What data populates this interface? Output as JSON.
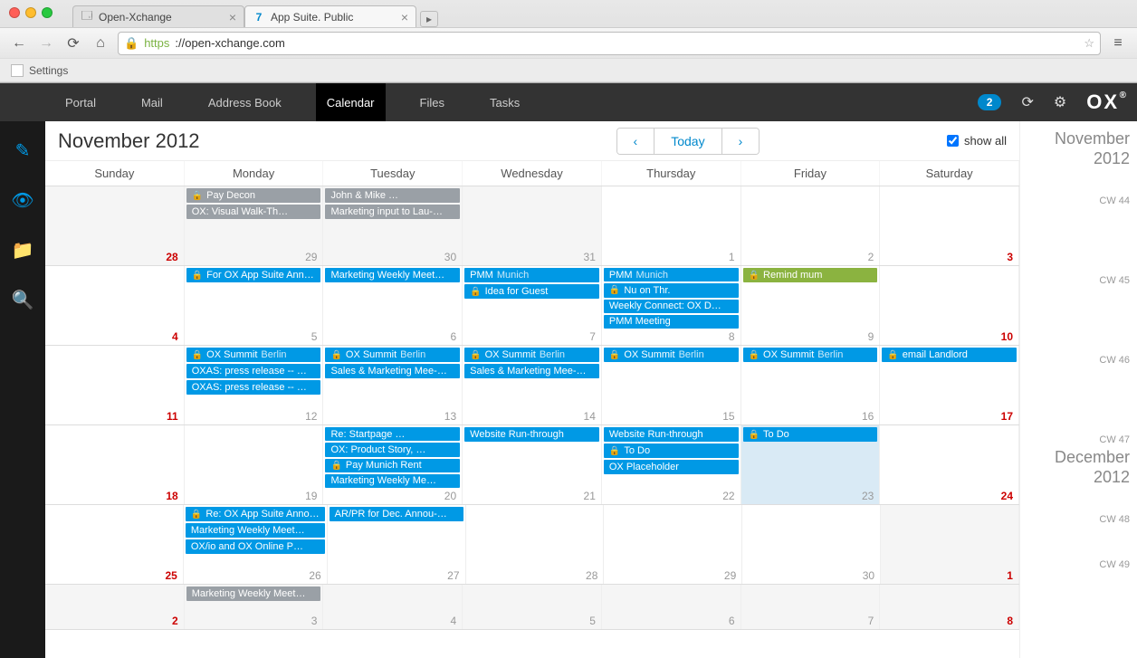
{
  "browser": {
    "tabs": [
      {
        "title": "Open-Xchange",
        "active": false
      },
      {
        "title": "App Suite. Public",
        "active": true
      }
    ],
    "url_proto": "https",
    "url_host": "://open-xchange.com",
    "bookmark": "Settings"
  },
  "nav": {
    "items": [
      "Portal",
      "Mail",
      "Address Book",
      "Calendar",
      "Files",
      "Tasks"
    ],
    "active": "Calendar",
    "badge": "2",
    "logo": "OX"
  },
  "calendar": {
    "title": "November 2012",
    "today_label": "Today",
    "show_all_label": "show all",
    "dow": [
      "Sunday",
      "Monday",
      "Tuesday",
      "Wednesday",
      "Thursday",
      "Friday",
      "Saturday"
    ],
    "weeks": [
      {
        "cw": "CW 44",
        "month_heading": {
          "text_a": "November",
          "text_b": "2012"
        },
        "days": [
          {
            "num": "28",
            "red": true,
            "out": true,
            "events": []
          },
          {
            "num": "29",
            "out": true,
            "events": [
              {
                "c": "gray",
                "lock": true,
                "text": "Pay Decon"
              },
              {
                "c": "gray",
                "lock": false,
                "text": "OX: Visual Walk-Th…"
              }
            ]
          },
          {
            "num": "30",
            "out": true,
            "events": [
              {
                "c": "gray",
                "lock": false,
                "text": "John & Mike …"
              },
              {
                "c": "gray",
                "lock": false,
                "text": "Marketing input to Lau-…"
              }
            ]
          },
          {
            "num": "31",
            "out": true,
            "events": []
          },
          {
            "num": "1",
            "events": []
          },
          {
            "num": "2",
            "events": []
          },
          {
            "num": "3",
            "red": true,
            "events": []
          }
        ]
      },
      {
        "cw": "CW 45",
        "days": [
          {
            "num": "4",
            "red": true,
            "events": []
          },
          {
            "num": "5",
            "events": [
              {
                "c": "blue",
                "lock": true,
                "text": "For OX App Suite Ann…"
              }
            ]
          },
          {
            "num": "6",
            "events": [
              {
                "c": "blue",
                "lock": false,
                "text": "Marketing Weekly Meet…"
              }
            ]
          },
          {
            "num": "7",
            "events": [
              {
                "c": "blue",
                "lock": false,
                "text": "PMM",
                "loc": "Munich"
              },
              {
                "c": "blue",
                "lock": true,
                "text": "Idea for Guest"
              }
            ]
          },
          {
            "num": "8",
            "events": [
              {
                "c": "blue",
                "lock": false,
                "text": "PMM",
                "loc": "Munich"
              },
              {
                "c": "blue",
                "lock": true,
                "text": "Nu on Thr."
              },
              {
                "c": "blue",
                "lock": false,
                "text": "Weekly Connect: OX D…"
              },
              {
                "c": "blue",
                "lock": false,
                "text": "PMM Meeting"
              }
            ]
          },
          {
            "num": "9",
            "events": [
              {
                "c": "green",
                "lock": true,
                "text": "Remind mum"
              }
            ]
          },
          {
            "num": "10",
            "red": true,
            "events": []
          }
        ]
      },
      {
        "cw": "CW 46",
        "days": [
          {
            "num": "11",
            "red": true,
            "events": []
          },
          {
            "num": "12",
            "events": [
              {
                "c": "blue",
                "lock": true,
                "text": "OX Summit",
                "loc": "Berlin"
              },
              {
                "c": "blue",
                "lock": false,
                "text": "OXAS: press release -- …"
              },
              {
                "c": "blue",
                "lock": false,
                "text": "OXAS: press release -- …"
              }
            ]
          },
          {
            "num": "13",
            "events": [
              {
                "c": "blue",
                "lock": true,
                "text": "OX Summit",
                "loc": "Berlin"
              },
              {
                "c": "blue",
                "lock": false,
                "text": "Sales & Marketing Mee-…"
              }
            ]
          },
          {
            "num": "14",
            "events": [
              {
                "c": "blue",
                "lock": true,
                "text": "OX Summit",
                "loc": "Berlin"
              },
              {
                "c": "blue",
                "lock": false,
                "text": "Sales & Marketing Mee-…"
              }
            ]
          },
          {
            "num": "15",
            "events": [
              {
                "c": "blue",
                "lock": true,
                "text": "OX Summit",
                "loc": "Berlin"
              }
            ]
          },
          {
            "num": "16",
            "events": [
              {
                "c": "blue",
                "lock": true,
                "text": "OX Summit",
                "loc": "Berlin"
              }
            ]
          },
          {
            "num": "17",
            "red": true,
            "events": [
              {
                "c": "blue",
                "lock": true,
                "text": "email Landlord"
              }
            ]
          }
        ]
      },
      {
        "cw": "CW 47",
        "days": [
          {
            "num": "18",
            "red": true,
            "events": []
          },
          {
            "num": "19",
            "events": []
          },
          {
            "num": "20",
            "events": [
              {
                "c": "blue",
                "lock": false,
                "text": "Re: Startpage …"
              },
              {
                "c": "blue",
                "lock": false,
                "text": "OX: Product Story, …"
              },
              {
                "c": "blue",
                "lock": true,
                "text": "Pay Munich Rent"
              },
              {
                "c": "blue",
                "lock": false,
                "text": "Marketing Weekly Me…"
              }
            ]
          },
          {
            "num": "21",
            "events": [
              {
                "c": "blue",
                "lock": false,
                "text": "Website Run-through"
              }
            ]
          },
          {
            "num": "22",
            "events": [
              {
                "c": "blue",
                "lock": false,
                "text": "Website Run-through"
              },
              {
                "c": "blue",
                "lock": true,
                "text": "To Do"
              },
              {
                "c": "blue",
                "lock": false,
                "text": "OX Placeholder"
              }
            ]
          },
          {
            "num": "23",
            "today": true,
            "events": [
              {
                "c": "blue",
                "lock": true,
                "text": "To Do"
              }
            ]
          },
          {
            "num": "24",
            "red": true,
            "events": []
          }
        ]
      },
      {
        "cw": "CW 48",
        "month_heading": {
          "text_a": "December",
          "text_b": "2012"
        },
        "days": [
          {
            "num": "25",
            "red": true,
            "events": []
          },
          {
            "num": "26",
            "events": [
              {
                "c": "blue",
                "lock": true,
                "text": "Re: OX App Suite Anno…"
              },
              {
                "c": "blue",
                "lock": false,
                "text": "Marketing Weekly Meet…"
              },
              {
                "c": "blue",
                "lock": false,
                "text": "OX/io and OX Online P…"
              }
            ]
          },
          {
            "num": "27",
            "events": [
              {
                "c": "blue",
                "lock": false,
                "text": "AR/PR for Dec. Annou-…"
              }
            ]
          },
          {
            "num": "28",
            "events": []
          },
          {
            "num": "29",
            "events": []
          },
          {
            "num": "30",
            "events": []
          },
          {
            "num": "1",
            "red": true,
            "out": true,
            "events": []
          }
        ]
      },
      {
        "cw": "CW 49",
        "days": [
          {
            "num": "2",
            "red": true,
            "out": true,
            "events": []
          },
          {
            "num": "3",
            "out": true,
            "events": [
              {
                "c": "gray",
                "lock": false,
                "text": "Marketing Weekly Meet…"
              }
            ]
          },
          {
            "num": "4",
            "out": true,
            "events": []
          },
          {
            "num": "5",
            "out": true,
            "events": []
          },
          {
            "num": "6",
            "out": true,
            "events": []
          },
          {
            "num": "7",
            "out": true,
            "events": []
          },
          {
            "num": "8",
            "red": true,
            "out": true,
            "events": []
          }
        ]
      }
    ]
  }
}
